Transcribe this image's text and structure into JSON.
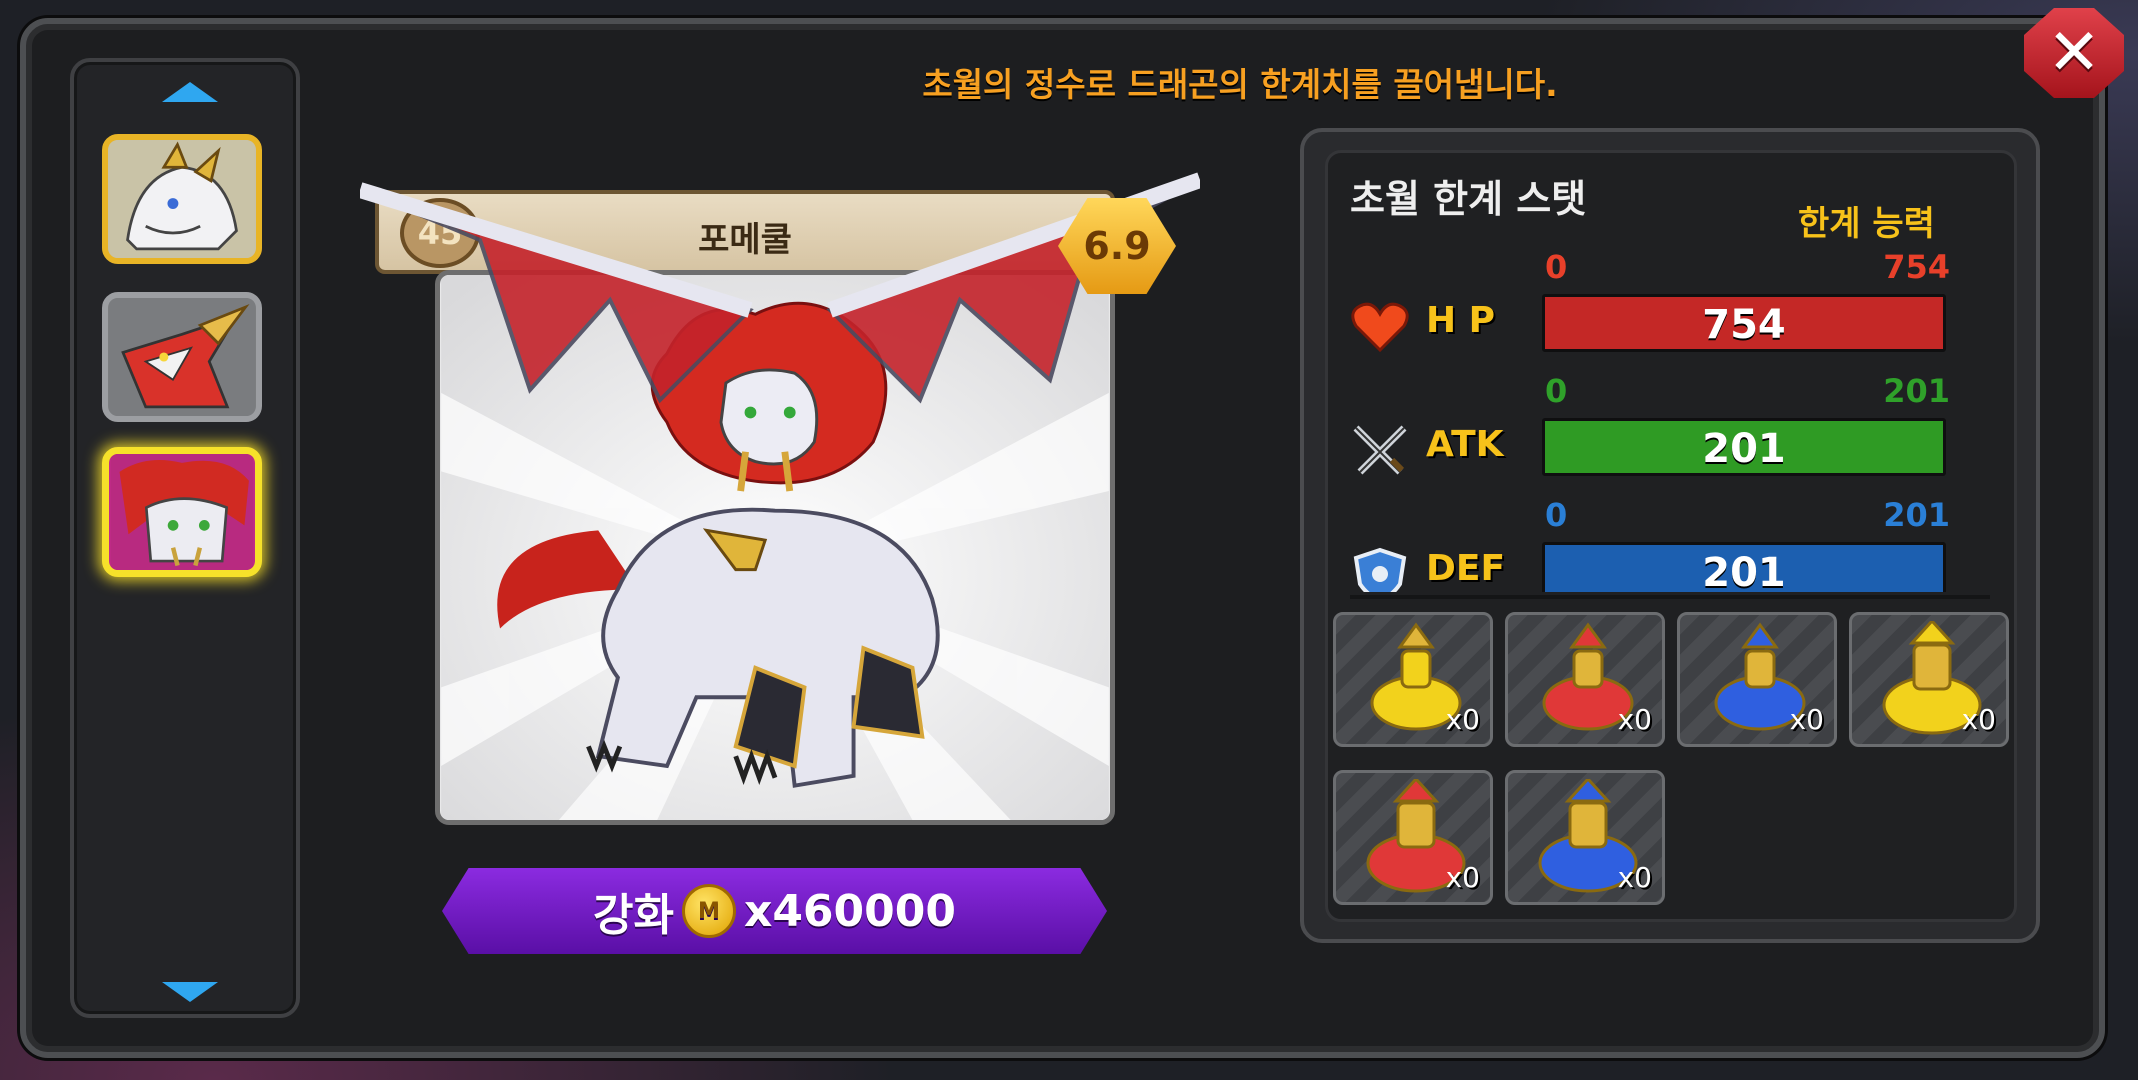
{
  "header": {
    "description": "초월의 정수로 드래곤의 한계치를 끌어냅니다."
  },
  "sidebar": {
    "arrow_up_icon": "arrow-up-icon",
    "arrow_down_icon": "arrow-down-icon",
    "dragons": [
      {
        "name": "white-golden-dragon",
        "border": "#e8b426"
      },
      {
        "name": "red-armored-dragon",
        "border": "#9c9ea2"
      },
      {
        "name": "red-maned-lion-dragon",
        "border": "#f6e12a",
        "selected": true
      }
    ]
  },
  "card": {
    "name": "포메쿨",
    "level": "45",
    "grade": "6.9"
  },
  "upgrade": {
    "label": "강화",
    "cost": "x460000",
    "coin_icon": "gold-coin-icon"
  },
  "stats": {
    "title": "초월 한계 스탯",
    "limit_label": "한계 능력",
    "rows": [
      {
        "name": "H P",
        "min": "0",
        "max": "754",
        "value": "754",
        "fill": 1.0,
        "color": "#c42826",
        "label_color": "#e8402a",
        "icon": "heart-icon"
      },
      {
        "name": "ATK",
        "min": "0",
        "max": "201",
        "value": "201",
        "fill": 1.0,
        "color": "#2f9b24",
        "label_color": "#2fa12a",
        "icon": "crossed-swords-icon"
      },
      {
        "name": "DEF",
        "min": "0",
        "max": "201",
        "value": "201",
        "fill": 1.0,
        "color": "#1c5fb0",
        "label_color": "#2a7fd6",
        "icon": "shield-icon"
      }
    ]
  },
  "potions": [
    {
      "name": "yellow-potion",
      "count": "x0",
      "color": "#f2d21c"
    },
    {
      "name": "red-potion",
      "count": "x0",
      "color": "#e03838"
    },
    {
      "name": "blue-potion",
      "count": "x0",
      "color": "#2f5fe0"
    },
    {
      "name": "large-yellow-potion",
      "count": "x0",
      "color": "#f2d21c"
    },
    {
      "name": "large-red-potion",
      "count": "x0",
      "color": "#e03838"
    },
    {
      "name": "large-blue-potion",
      "count": "x0",
      "color": "#2f5fe0"
    }
  ]
}
